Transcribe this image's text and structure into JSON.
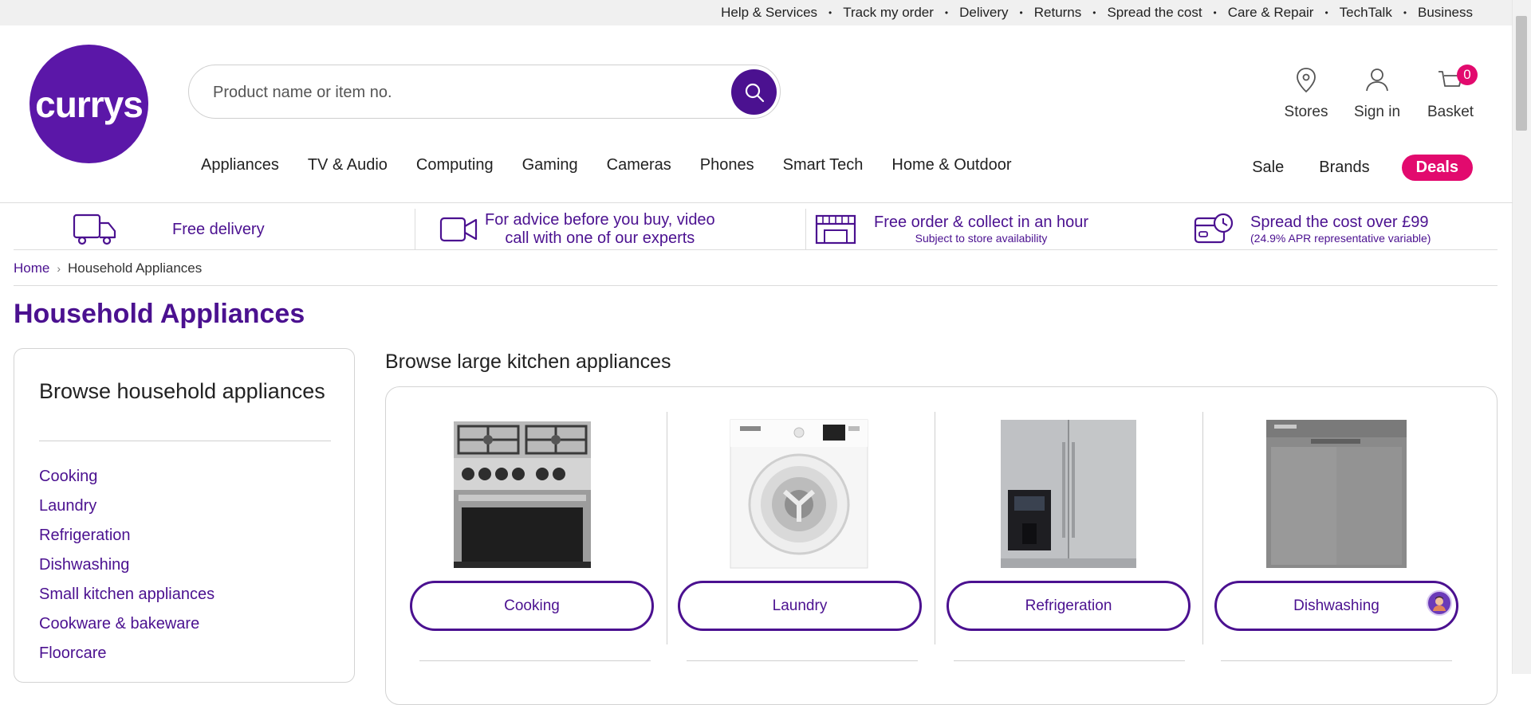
{
  "utility_nav": [
    "Help & Services",
    "Track my order",
    "Delivery",
    "Returns",
    "Spread the cost",
    "Care & Repair",
    "TechTalk",
    "Business"
  ],
  "logo": {
    "text": "currys"
  },
  "search": {
    "placeholder": "Product name or item no."
  },
  "header_actions": {
    "stores": "Stores",
    "sign_in": "Sign in",
    "basket": "Basket",
    "basket_count": "0"
  },
  "main_nav": [
    "Appliances",
    "TV & Audio",
    "Computing",
    "Gaming",
    "Cameras",
    "Phones",
    "Smart Tech",
    "Home & Outdoor"
  ],
  "nav_right": {
    "sale": "Sale",
    "brands": "Brands",
    "deals": "Deals"
  },
  "usp": {
    "delivery": "Free delivery",
    "video_line1": "For advice before you buy, video",
    "video_line2": "call with one of our experts",
    "collect_title": "Free order & collect in an hour",
    "collect_sub": "Subject to store availability",
    "finance_title": "Spread the cost over £99",
    "finance_sub": "(24.9% APR representative variable)"
  },
  "breadcrumb": {
    "home": "Home",
    "current": "Household Appliances"
  },
  "page_title": "Household Appliances",
  "sidebar": {
    "heading": "Browse household appliances",
    "items": [
      "Cooking",
      "Laundry",
      "Refrigeration",
      "Dishwashing",
      "Small kitchen appliances",
      "Cookware & bakeware",
      "Floorcare"
    ]
  },
  "browse": {
    "title": "Browse large kitchen appliances",
    "cards": [
      {
        "label": "Cooking",
        "icon": "range-cooker-image"
      },
      {
        "label": "Laundry",
        "icon": "washing-machine-image"
      },
      {
        "label": "Refrigeration",
        "icon": "fridge-freezer-image"
      },
      {
        "label": "Dishwashing",
        "icon": "dishwasher-image"
      }
    ]
  },
  "colors": {
    "brand_purple": "#4b1190",
    "logo_purple": "#5b17a8",
    "deals_pink": "#e20a6e"
  }
}
